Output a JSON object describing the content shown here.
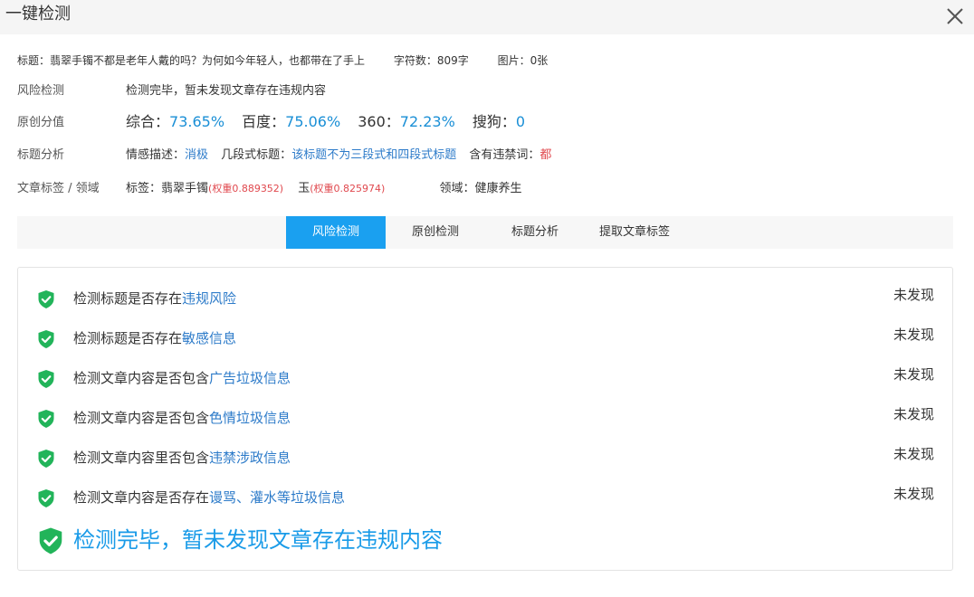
{
  "dialog": {
    "title": "一键检测"
  },
  "meta": {
    "title_prefix": "标题：",
    "title_text": "翡翠手镯不都是老年人戴的吗？为何如今年轻人，也都带在了手上",
    "char_count": "字符数：809字",
    "images": "图片：0张"
  },
  "risk": {
    "label": "风险检测",
    "value": "检测完毕，暂未发现文章存在违规内容"
  },
  "originality": {
    "label": "原创分值",
    "overall_label": "综合：",
    "overall_value": "73.65%",
    "baidu_label": "百度：",
    "baidu_value": "75.06%",
    "s360_label": "360：",
    "s360_value": "72.23%",
    "sogou_label": "搜狗：",
    "sogou_value": "0"
  },
  "title_analysis": {
    "label": "标题分析",
    "sentiment_label": "情感描述：",
    "sentiment_value": "消极",
    "segment_label": "几段式标题：",
    "segment_value": "该标题不为三段式和四段式标题",
    "banned_label": "含有违禁词：",
    "banned_value": "都"
  },
  "tags": {
    "label": "文章标签 / 领域",
    "tags_prefix": "标签：",
    "tag1_name": "翡翠手镯",
    "tag1_weight": "(权重0.889352)",
    "tag2_name": "玉",
    "tag2_weight": "(权重0.825974)",
    "domain_prefix": "领域：",
    "domain_value": "健康养生"
  },
  "tabs": [
    {
      "label": "风险检测",
      "active": true
    },
    {
      "label": "原创检测",
      "active": false
    },
    {
      "label": "标题分析",
      "active": false
    },
    {
      "label": "提取文章标签",
      "active": false
    }
  ],
  "checks": [
    {
      "prefix": "检测标题是否存在",
      "highlight": "违规风险",
      "status": "未发现"
    },
    {
      "prefix": "检测标题是否存在",
      "highlight": "敏感信息",
      "status": "未发现"
    },
    {
      "prefix": "检测文章内容是否包含",
      "highlight": "广告垃圾信息",
      "status": "未发现"
    },
    {
      "prefix": "检测文章内容是否包含",
      "highlight": "色情垃圾信息",
      "status": "未发现"
    },
    {
      "prefix": "检测文章内容里否包含",
      "highlight": "违禁涉政信息",
      "status": "未发现"
    },
    {
      "prefix": "检测文章内容是否存在",
      "highlight": "谩骂、灌水等垃圾信息",
      "status": "未发现"
    }
  ],
  "summary": {
    "text": "检测完毕，暂未发现文章存在违规内容"
  },
  "colors": {
    "accent": "#1aa0f0",
    "score_blue": "#1a8fd6",
    "link_blue": "#2d7bc9",
    "warn_red": "#e0484e",
    "shield_green": "#22b45a"
  },
  "icons": {
    "close": "close-icon",
    "shield": "shield-check-icon"
  }
}
